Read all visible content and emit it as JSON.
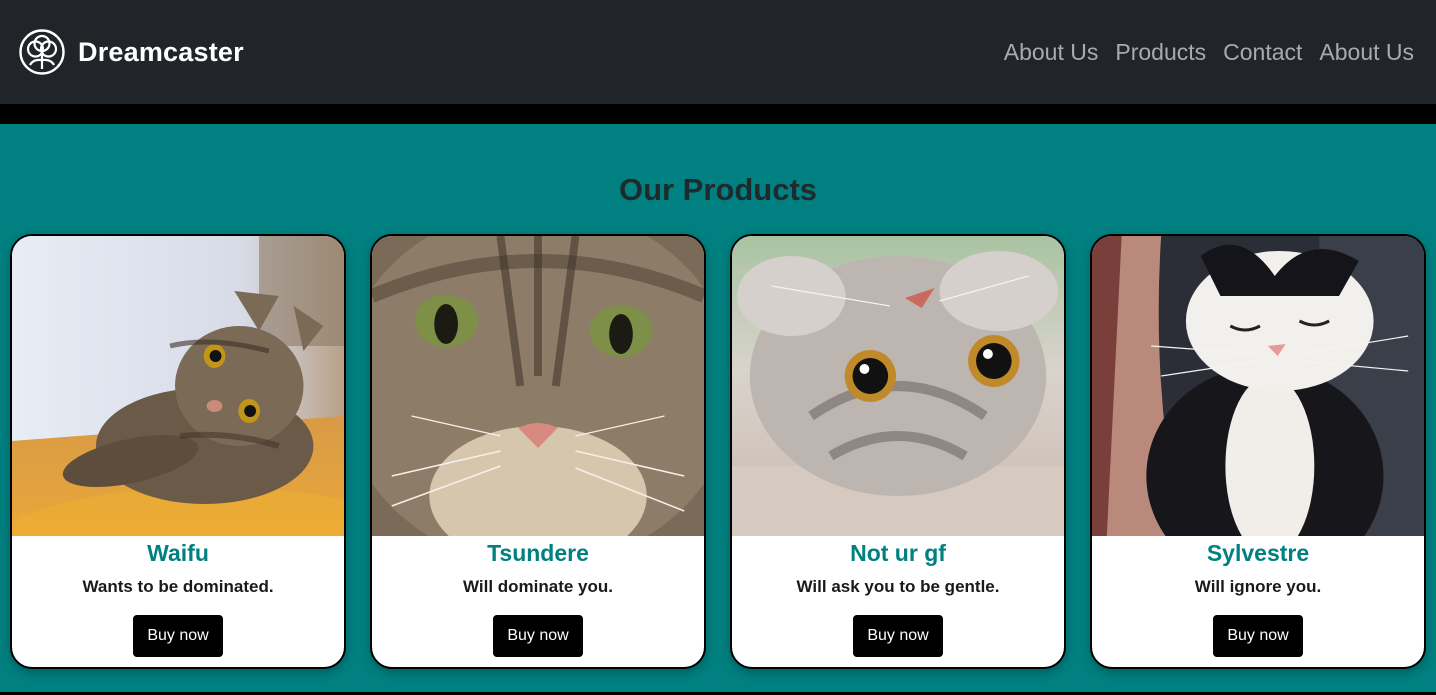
{
  "navbar": {
    "brand_name": "Dreamcaster",
    "brand_icon": "flower-logo-icon",
    "links": [
      {
        "label": "About Us"
      },
      {
        "label": "Products"
      },
      {
        "label": "Contact"
      },
      {
        "label": "About Us"
      }
    ]
  },
  "products_section": {
    "title": "Our Products",
    "products": [
      {
        "name": "Waifu",
        "description": "Wants to be dominated.",
        "button_label": "Buy now",
        "image": "tabby-cat-lying-on-floor-photo"
      },
      {
        "name": "Tsundere",
        "description": "Will dominate you.",
        "button_label": "Buy now",
        "image": "grumpy-tabby-cat-closeup-photo"
      },
      {
        "name": "Not ur gf",
        "description": "Will ask you to be gentle.",
        "button_label": "Buy now",
        "image": "upside-down-grey-cat-photo"
      },
      {
        "name": "Sylvestre",
        "description": "Will ignore you.",
        "button_label": "Buy now",
        "image": "black-white-cat-eyes-closed-photo"
      }
    ]
  },
  "colors": {
    "navbar_bg": "#212529",
    "main_bg": "#008080",
    "accent_title": "#008080",
    "button_bg": "#000000"
  }
}
